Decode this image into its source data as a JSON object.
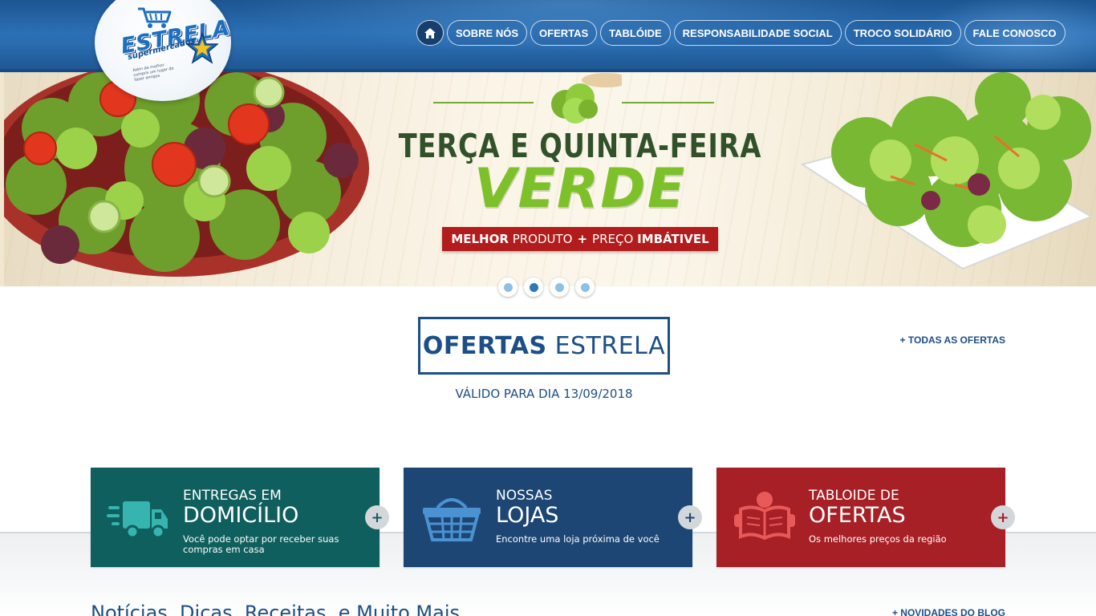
{
  "brand": {
    "name": "ESTRELA",
    "subtitle": "supermercados",
    "tagline": "Além de melhor compra um lugar de fazer amigos"
  },
  "nav": {
    "items": [
      {
        "label": "SOBRE NÓS"
      },
      {
        "label": "OFERTAS"
      },
      {
        "label": "TABLÓIDE"
      },
      {
        "label": "RESPONSABILIDADE SOCIAL"
      },
      {
        "label": "TROCO SOLIDÁRIO"
      },
      {
        "label": "FALE CONOSCO"
      }
    ]
  },
  "banner": {
    "title_line1": "TERÇA E QUINTA-FEIRA",
    "title_line2": "VERDE",
    "pill_part1_bold": "MELHOR",
    "pill_part1": "PRODUTO",
    "pill_plus": "+",
    "pill_part2": "PREÇO",
    "pill_part2_bold": "IMBÁTIVEL",
    "slides": 4,
    "active_slide": 2
  },
  "ofertas": {
    "title_bold": "OFERTAS",
    "title_light": "ESTRELA",
    "valid_text": "VÁLIDO PARA DIA 13/09/2018",
    "all_link": "+ TODAS AS OFERTAS"
  },
  "cards": [
    {
      "small": "ENTREGAS EM",
      "big": "DOMICÍLIO",
      "desc": "Você pode optar por receber suas compras em casa",
      "icon": "truck-icon",
      "color": "#0f5f5e"
    },
    {
      "small": "NOSSAS",
      "big": "LOJAS",
      "desc": "Encontre uma loja próxima de você",
      "icon": "basket-icon",
      "color": "#1d4674"
    },
    {
      "small": "TABLOIDE DE",
      "big": "OFERTAS",
      "desc": "Os melhores preços da região",
      "icon": "reader-icon",
      "color": "#a72026"
    }
  ],
  "plus_symbol": "+",
  "news": {
    "title": "Notícias, Dicas, Receitas, e Muito Mais",
    "link": "+ NOVIDADES DO BLOG"
  },
  "colors": {
    "header_blue": "#2b6fb4",
    "brand_navy": "#1c4f86",
    "banner_green": "#7dc12a",
    "banner_red": "#b31c1c"
  }
}
